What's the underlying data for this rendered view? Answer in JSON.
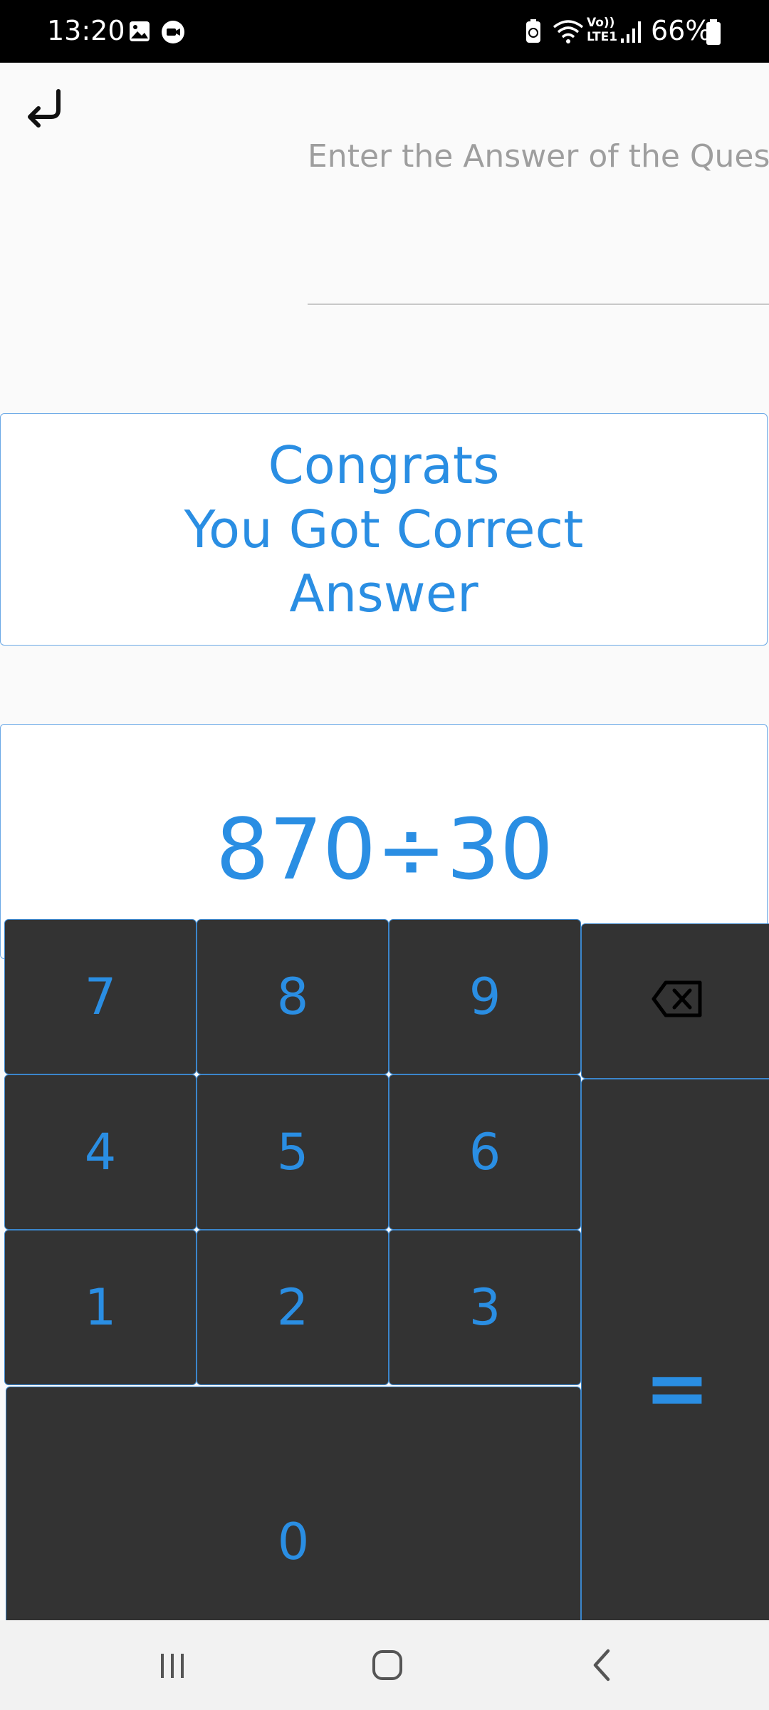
{
  "status_bar": {
    "time": "13:20",
    "battery": "66%",
    "icons": [
      "gallery-icon",
      "video-call-icon",
      "battery-saver-icon",
      "wifi-icon",
      "volte-icon",
      "signal-icon",
      "battery-icon"
    ],
    "volte_text": "Vo))\nLTE1"
  },
  "header": {
    "back_icon": "return-arrow-icon"
  },
  "answer": {
    "placeholder": "Enter the Answer of the Question",
    "value": ""
  },
  "feedback": {
    "message": "Congrats\nYou Got Correct\nAnswer"
  },
  "question": {
    "text": "870÷30"
  },
  "keypad": {
    "keys": [
      "7",
      "8",
      "9",
      "4",
      "5",
      "6",
      "1",
      "2",
      "3",
      "0"
    ],
    "backspace_icon": "backspace-icon",
    "equals": "="
  },
  "nav": {
    "recents_icon": "recents-icon",
    "home_icon": "home-icon",
    "back_icon": "back-chevron-icon"
  },
  "colors": {
    "accent": "#2a8ee3",
    "key_bg": "#333333",
    "border": "#6aa8e6"
  }
}
